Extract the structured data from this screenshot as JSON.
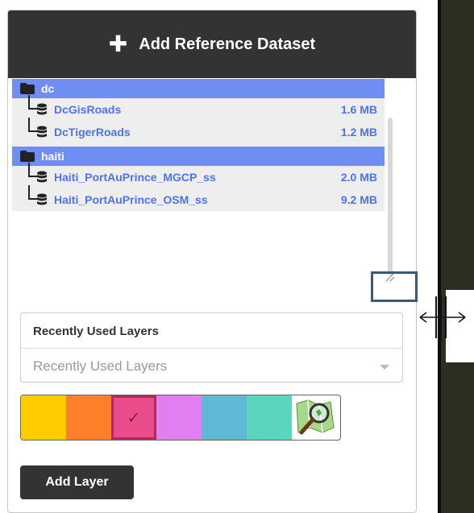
{
  "header": {
    "icon": "plus-icon",
    "title": "Add Reference Dataset"
  },
  "tree": {
    "folders": [
      {
        "name": "dc",
        "icon": "folder-icon",
        "layers": [
          {
            "name": "DcGisRoads",
            "size": "1.6 MB",
            "icon": "database-icon"
          },
          {
            "name": "DcTigerRoads",
            "size": "1.2 MB",
            "icon": "database-icon"
          }
        ]
      },
      {
        "name": "haiti",
        "icon": "folder-icon",
        "layers": [
          {
            "name": "Haiti_PortAuPrince_MGCP_ss",
            "size": "2.0 MB",
            "icon": "database-icon"
          },
          {
            "name": "Haiti_PortAuPrince_OSM_ss",
            "size": "9.2 MB",
            "icon": "database-icon"
          }
        ]
      }
    ]
  },
  "recent": {
    "label": "Recently Used Layers",
    "placeholder": "Recently Used Layers"
  },
  "palette": {
    "colors": [
      "#ffcc00",
      "#ff7f2a",
      "#ea4c89",
      "#e37ef0",
      "#5fb8d5",
      "#5ad5be"
    ],
    "selected_index": 2,
    "selected_icon": "check-icon",
    "extra_icon": "osm-magnifier-icon"
  },
  "add_layer_label": "Add Layer",
  "colors": {
    "header_bg": "#333333",
    "folder_row_bg": "#6e8ef4",
    "layer_text": "#4f73e8",
    "tree_bg": "#eeeeee"
  }
}
